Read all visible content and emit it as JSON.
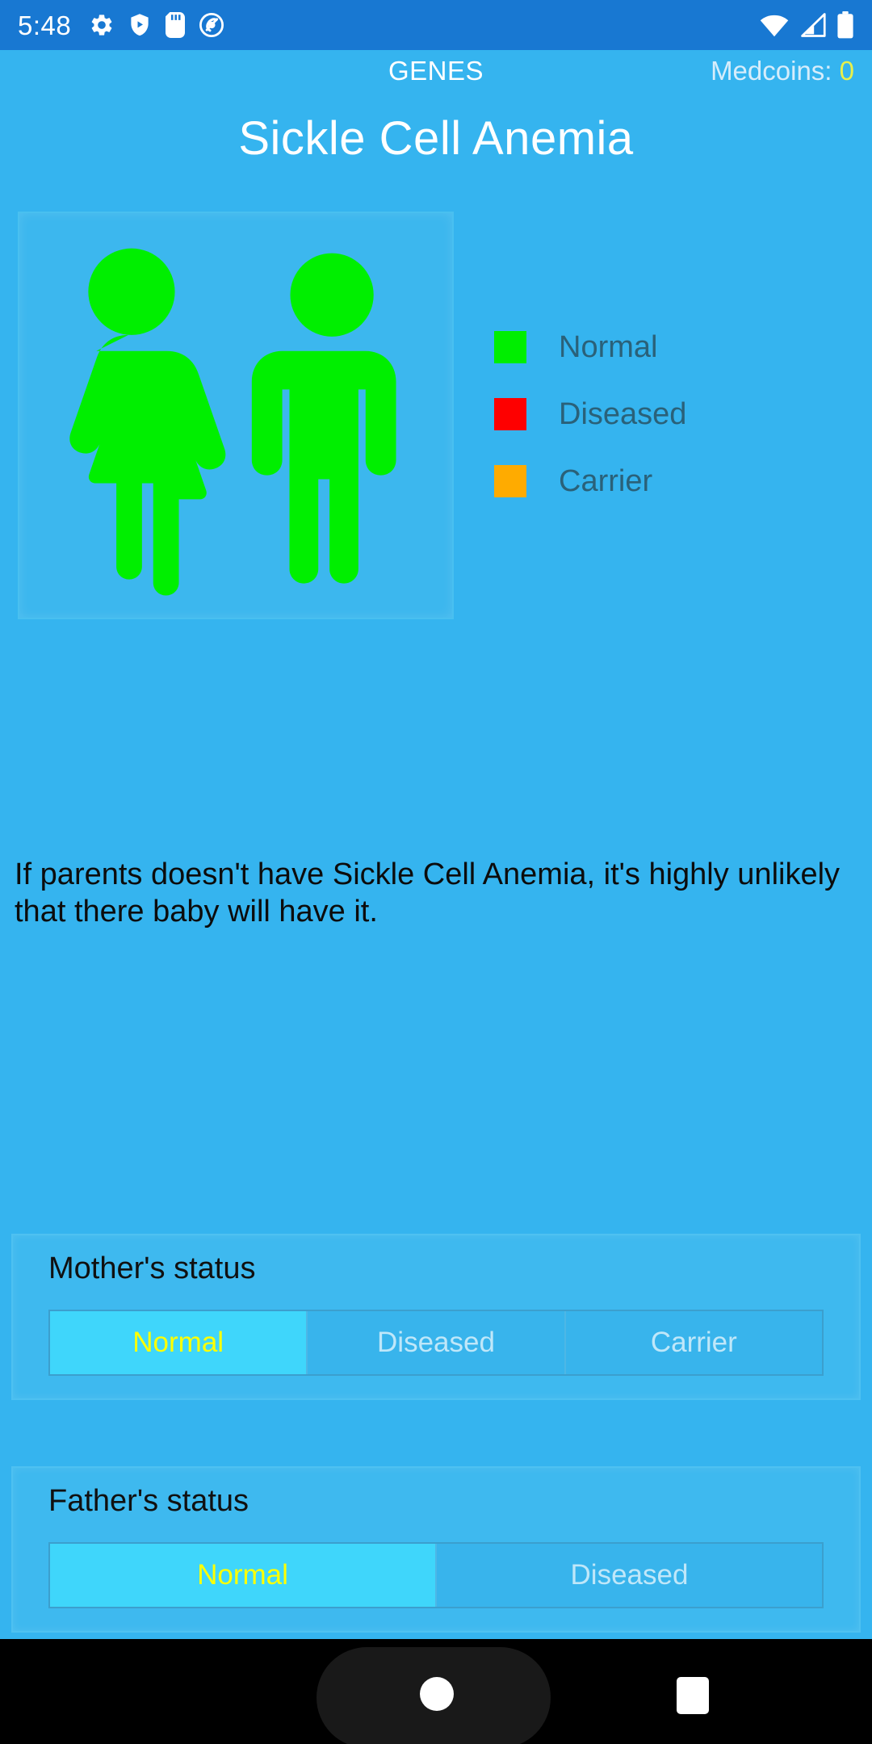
{
  "status_bar": {
    "clock": "5:48",
    "left_icons": [
      "gear-icon",
      "shield-play-icon",
      "sd-card-icon",
      "circle-q-icon"
    ],
    "right_icons": [
      "wifi-icon",
      "cellular-signal-icon",
      "battery-icon"
    ],
    "background_color": "#1878d2"
  },
  "app_bar": {
    "title": "GENES",
    "medcoins_label": "Medcoins: ",
    "medcoins_value": "0",
    "medcoins_value_color": "#e8f04a"
  },
  "page": {
    "title": "Sickle Cell Anemia",
    "background_color": "#35b4ef",
    "info_text": "If parents doesn't have Sickle Cell Anemia, it's highly unlikely that there baby will have it."
  },
  "illustration": {
    "mother_icon": "female-figure-icon",
    "father_icon": "male-figure-icon",
    "mother_color": "#00ef00",
    "father_color": "#00ef00"
  },
  "legend": {
    "items": [
      {
        "label": "Normal",
        "color": "#00ee00"
      },
      {
        "label": "Diseased",
        "color": "#fe0000"
      },
      {
        "label": "Carrier",
        "color": "#ffab00"
      }
    ]
  },
  "mother_status": {
    "label": "Mother's status",
    "options": [
      "Normal",
      "Diseased",
      "Carrier"
    ],
    "selected": "Normal",
    "selected_text_color": "#ffff00"
  },
  "father_status": {
    "label": "Father's status",
    "options": [
      "Normal",
      "Diseased"
    ],
    "selected": "Normal",
    "selected_text_color": "#ffff00"
  },
  "nav_bar": {
    "home_icon": "home-circle-icon",
    "recents_icon": "recents-square-icon",
    "background_color": "#000000"
  }
}
